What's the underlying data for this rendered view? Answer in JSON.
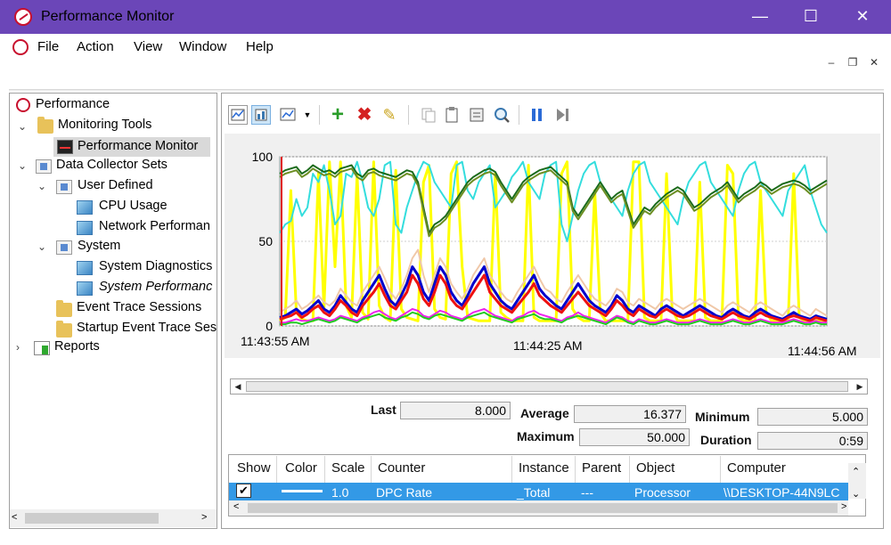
{
  "window": {
    "title": "Performance Monitor",
    "controls": {
      "minimize": "—",
      "maximize": "☐",
      "close": "✕"
    },
    "title_color": "#6b46b8"
  },
  "menu": {
    "items": [
      "File",
      "Action",
      "View",
      "Window",
      "Help"
    ]
  },
  "mdi_controls": {
    "minimize": "–",
    "restore": "❐",
    "close": "✕"
  },
  "tree": {
    "items": [
      {
        "label": "Performance",
        "icon": "performance-icon"
      },
      {
        "label": "Monitoring Tools",
        "icon": "monitoring-tools-icon"
      },
      {
        "label": "Performance Monitor",
        "icon": "performance-monitor-icon",
        "selected": true
      },
      {
        "label": "Data Collector Sets",
        "icon": "data-collector-sets-icon"
      },
      {
        "label": "User Defined",
        "icon": "user-defined-icon"
      },
      {
        "label": "CPU Usage",
        "icon": "collector-set-icon"
      },
      {
        "label": "Network Performan",
        "icon": "collector-set-icon"
      },
      {
        "label": "System",
        "icon": "system-folder-icon"
      },
      {
        "label": "System Diagnostics",
        "icon": "collector-set-icon"
      },
      {
        "label": "System Performanc",
        "icon": "collector-set-icon"
      },
      {
        "label": "Event Trace Sessions",
        "icon": "folder-icon"
      },
      {
        "label": "Startup Event Trace Ses",
        "icon": "folder-icon"
      },
      {
        "label": "Reports",
        "icon": "reports-icon"
      }
    ]
  },
  "toolbar": {
    "icons": [
      "view-graph-icon",
      "view-histogram-icon",
      "change-graph-type-icon",
      "dropdown-arrow-icon",
      "add-counter-icon",
      "delete-counter-icon",
      "highlight-icon",
      "copy-properties-icon",
      "paste-counter-list-icon",
      "properties-icon",
      "zoom-icon",
      "freeze-display-icon",
      "update-data-icon"
    ]
  },
  "chart_data": {
    "type": "line",
    "title": "",
    "xlabel": "",
    "ylabel": "",
    "ylim": [
      0,
      100
    ],
    "y_ticks": [
      "0",
      "50",
      "100"
    ],
    "x_tick_labels": [
      "11:43:55 AM",
      "11:44:25 AM",
      "11:44:56 AM"
    ],
    "grid": true,
    "points_per_series": 100,
    "series": [
      {
        "color": "#ffff00",
        "values": [
          3,
          5,
          80,
          8,
          4,
          3,
          3,
          90,
          10,
          97,
          35,
          97,
          12,
          5,
          90,
          8,
          4,
          97,
          12,
          5,
          3,
          92,
          10,
          5,
          4,
          3,
          85,
          95,
          10,
          5,
          4,
          90,
          97,
          35,
          5,
          4,
          3,
          3,
          3,
          90,
          8,
          5,
          3,
          3,
          3,
          95,
          5,
          3,
          3,
          3,
          3,
          90,
          97,
          10,
          5,
          3,
          3,
          80,
          8,
          3,
          3,
          3,
          3,
          3,
          97,
          97,
          5,
          3,
          3,
          3,
          90,
          10,
          3,
          3,
          3,
          3,
          85,
          5,
          3,
          3,
          3,
          95,
          90,
          5,
          3,
          3,
          3,
          80,
          8,
          3,
          3,
          3,
          3,
          90,
          5,
          3,
          3,
          3,
          3,
          3
        ]
      },
      {
        "color": "#33dddd",
        "values": [
          55,
          60,
          62,
          75,
          65,
          70,
          90,
          85,
          95,
          80,
          60,
          65,
          90,
          88,
          97,
          85,
          70,
          65,
          75,
          95,
          97,
          60,
          55,
          70,
          80,
          90,
          97,
          95,
          85,
          80,
          75,
          70,
          95,
          97,
          80,
          75,
          85,
          90,
          95,
          70,
          75,
          80,
          88,
          92,
          97,
          85,
          80,
          75,
          90,
          95,
          97,
          60,
          50,
          65,
          80,
          90,
          95,
          97,
          85,
          80,
          75,
          70,
          65,
          80,
          90,
          95,
          97,
          85,
          80,
          75,
          70,
          65,
          60,
          75,
          85,
          90,
          95,
          97,
          85,
          80,
          75,
          70,
          65,
          80,
          90,
          95,
          97,
          85,
          80,
          75,
          70,
          65,
          80,
          85,
          90,
          95,
          80,
          70,
          60,
          55
        ]
      },
      {
        "color": "#1b6b1b",
        "values": [
          90,
          92,
          93,
          94,
          90,
          92,
          95,
          93,
          91,
          92,
          90,
          93,
          94,
          95,
          90,
          88,
          92,
          93,
          91,
          90,
          89,
          88,
          90,
          92,
          91,
          85,
          70,
          55,
          60,
          62,
          65,
          70,
          75,
          80,
          85,
          88,
          90,
          92,
          93,
          91,
          85,
          80,
          75,
          80,
          85,
          88,
          90,
          92,
          93,
          94,
          91,
          88,
          85,
          70,
          65,
          70,
          75,
          80,
          85,
          80,
          75,
          78,
          80,
          70,
          60,
          65,
          70,
          68,
          72,
          75,
          78,
          80,
          82,
          80,
          75,
          70,
          72,
          75,
          78,
          80,
          82,
          85,
          80,
          75,
          78,
          80,
          82,
          85,
          83,
          80,
          82,
          84,
          85,
          86,
          85,
          83,
          80,
          82,
          84,
          86
        ]
      },
      {
        "color": "#6b8e23",
        "values": [
          88,
          90,
          91,
          92,
          88,
          90,
          93,
          91,
          89,
          90,
          88,
          91,
          92,
          93,
          88,
          86,
          90,
          91,
          89,
          88,
          87,
          86,
          88,
          90,
          89,
          83,
          68,
          53,
          58,
          60,
          63,
          68,
          73,
          78,
          83,
          86,
          88,
          90,
          91,
          89,
          83,
          78,
          73,
          78,
          83,
          86,
          88,
          90,
          91,
          92,
          89,
          86,
          83,
          68,
          63,
          68,
          73,
          78,
          83,
          78,
          73,
          76,
          78,
          68,
          58,
          63,
          68,
          66,
          70,
          73,
          76,
          78,
          80,
          78,
          73,
          68,
          70,
          73,
          76,
          78,
          80,
          83,
          78,
          73,
          76,
          78,
          80,
          83,
          81,
          78,
          80,
          82,
          83,
          84,
          83,
          81,
          78,
          80,
          82,
          84
        ]
      },
      {
        "color": "#0000cc",
        "values": [
          5,
          6,
          8,
          10,
          7,
          9,
          12,
          15,
          10,
          8,
          12,
          18,
          14,
          10,
          8,
          15,
          20,
          25,
          30,
          22,
          15,
          12,
          18,
          25,
          35,
          30,
          20,
          15,
          25,
          35,
          30,
          20,
          15,
          12,
          18,
          25,
          30,
          35,
          25,
          20,
          15,
          12,
          10,
          15,
          20,
          25,
          30,
          22,
          18,
          15,
          12,
          10,
          15,
          20,
          25,
          20,
          15,
          12,
          10,
          8,
          12,
          18,
          15,
          10,
          8,
          12,
          10,
          8,
          6,
          10,
          12,
          10,
          8,
          6,
          8,
          10,
          12,
          10,
          8,
          6,
          5,
          8,
          10,
          8,
          6,
          5,
          8,
          10,
          8,
          6,
          5,
          4,
          6,
          8,
          6,
          5,
          4,
          6,
          5,
          4
        ]
      },
      {
        "color": "#ee1111",
        "values": [
          4,
          5,
          6,
          8,
          5,
          7,
          10,
          12,
          8,
          6,
          10,
          15,
          12,
          8,
          6,
          12,
          16,
          20,
          25,
          18,
          12,
          10,
          15,
          20,
          30,
          25,
          16,
          12,
          20,
          30,
          25,
          16,
          12,
          10,
          15,
          20,
          25,
          30,
          20,
          16,
          12,
          10,
          8,
          12,
          16,
          20,
          25,
          18,
          15,
          12,
          10,
          8,
          12,
          16,
          20,
          16,
          12,
          10,
          8,
          6,
          10,
          15,
          12,
          8,
          6,
          10,
          8,
          6,
          5,
          8,
          10,
          8,
          6,
          5,
          6,
          8,
          10,
          8,
          6,
          5,
          4,
          6,
          8,
          6,
          5,
          4,
          6,
          8,
          6,
          5,
          4,
          3,
          5,
          6,
          5,
          4,
          3,
          5,
          4,
          3
        ]
      },
      {
        "color": "#f0c8a8",
        "values": [
          8,
          10,
          12,
          15,
          10,
          12,
          15,
          18,
          14,
          12,
          15,
          22,
          18,
          14,
          12,
          20,
          25,
          30,
          35,
          28,
          20,
          16,
          22,
          30,
          40,
          45,
          30,
          20,
          30,
          40,
          35,
          25,
          20,
          16,
          22,
          30,
          35,
          40,
          30,
          25,
          20,
          16,
          14,
          20,
          25,
          30,
          35,
          28,
          22,
          20,
          16,
          14,
          20,
          25,
          30,
          25,
          20,
          16,
          14,
          12,
          16,
          22,
          20,
          14,
          12,
          16,
          14,
          12,
          10,
          14,
          16,
          14,
          12,
          10,
          12,
          14,
          16,
          14,
          12,
          10,
          8,
          12,
          14,
          12,
          10,
          8,
          12,
          14,
          12,
          10,
          8,
          6,
          10,
          12,
          10,
          8,
          6,
          10,
          8,
          6
        ]
      },
      {
        "color": "#ee22ee",
        "values": [
          2,
          2,
          3,
          4,
          3,
          3,
          4,
          5,
          4,
          3,
          4,
          6,
          5,
          4,
          3,
          5,
          6,
          8,
          9,
          7,
          5,
          4,
          6,
          8,
          10,
          9,
          6,
          5,
          7,
          9,
          8,
          6,
          5,
          4,
          6,
          8,
          9,
          10,
          8,
          6,
          5,
          4,
          3,
          5,
          6,
          8,
          9,
          7,
          6,
          5,
          4,
          3,
          5,
          6,
          8,
          6,
          5,
          4,
          3,
          2,
          4,
          6,
          5,
          3,
          2,
          4,
          3,
          2,
          2,
          3,
          4,
          3,
          2,
          2,
          2,
          3,
          4,
          3,
          2,
          2,
          2,
          3,
          4,
          3,
          2,
          2,
          3,
          4,
          3,
          2,
          2,
          2,
          3,
          4,
          3,
          2,
          2,
          3,
          2,
          2
        ]
      },
      {
        "color": "#22cc22",
        "values": [
          1,
          1,
          2,
          2,
          1,
          2,
          3,
          4,
          3,
          2,
          3,
          5,
          4,
          3,
          2,
          4,
          5,
          6,
          7,
          5,
          4,
          3,
          5,
          6,
          8,
          7,
          5,
          4,
          6,
          7,
          6,
          5,
          4,
          3,
          5,
          6,
          7,
          8,
          6,
          5,
          4,
          3,
          2,
          4,
          5,
          6,
          7,
          5,
          4,
          4,
          3,
          2,
          4,
          5,
          6,
          5,
          4,
          3,
          2,
          1,
          3,
          5,
          4,
          2,
          1,
          3,
          2,
          1,
          1,
          2,
          3,
          2,
          1,
          1,
          1,
          2,
          3,
          2,
          1,
          1,
          1,
          2,
          3,
          2,
          1,
          1,
          2,
          3,
          2,
          1,
          1,
          1,
          2,
          3,
          2,
          1,
          1,
          2,
          1,
          1
        ]
      }
    ]
  },
  "stats": {
    "last_label": "Last",
    "last_value": "8.000",
    "average_label": "Average",
    "average_value": "16.377",
    "minimum_label": "Minimum",
    "minimum_value": "5.000",
    "maximum_label": "Maximum",
    "maximum_value": "50.000",
    "duration_label": "Duration",
    "duration_value": "0:59"
  },
  "counter_table": {
    "headers": [
      "Show",
      "Color",
      "Scale",
      "Counter",
      "Instance",
      "Parent",
      "Object",
      "Computer"
    ],
    "rows": [
      {
        "show": "✔",
        "scale": "1.0",
        "counter": "DPC Rate",
        "instance": "_Total",
        "parent": "---",
        "object": "Processor",
        "computer": "\\\\DESKTOP-44N9LC"
      }
    ]
  }
}
